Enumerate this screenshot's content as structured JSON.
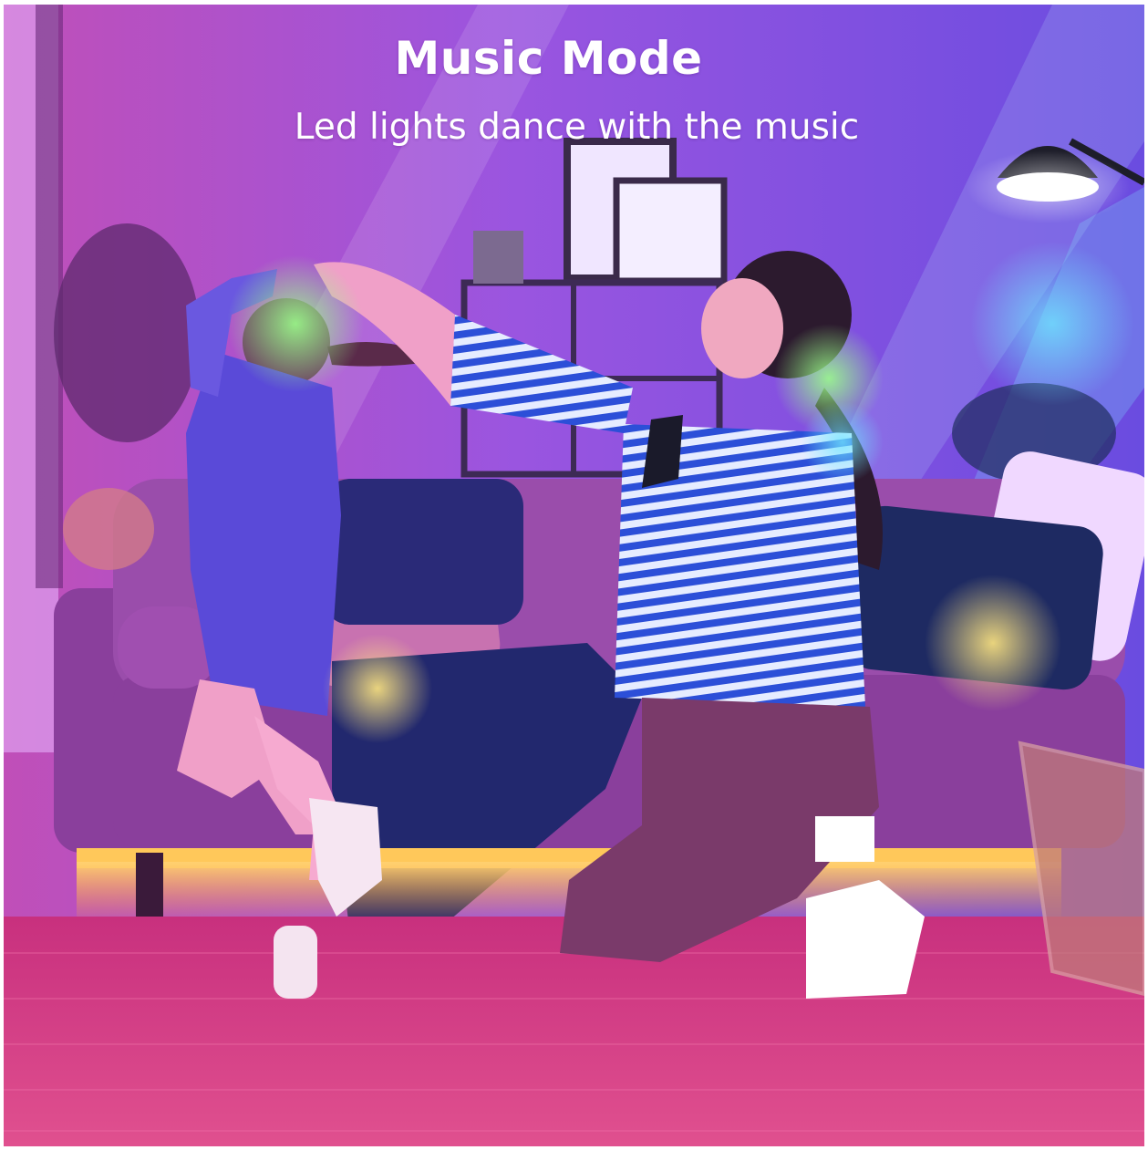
{
  "banner": {
    "title": "Music Mode",
    "subtitle": "Led lights dance with the music"
  },
  "photo": {
    "icon": "photo-illustration"
  },
  "colors": {
    "wall": "#8a3fd0",
    "led_glow": "#ffb030",
    "rug": "#d63f8c",
    "sofa": "#8e4aa6"
  }
}
